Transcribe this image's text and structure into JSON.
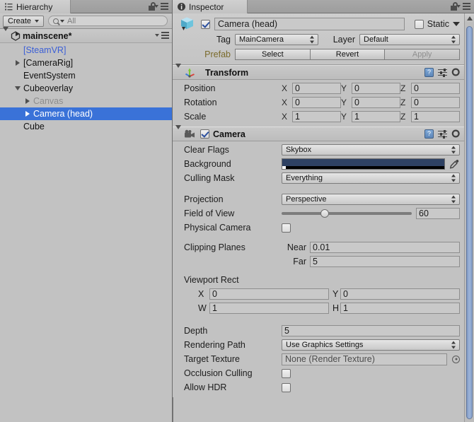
{
  "hierarchy": {
    "tab_label": "Hierarchy",
    "tab_icon": "hierarchy-icon",
    "lock_icon": "lock-icon",
    "menu_icon": "panel-menu-icon",
    "create_label": "Create",
    "search_value": "All",
    "search_icon": "search-icon",
    "scene_name": "mainscene*",
    "scene_icon": "unity-scene-icon",
    "items": [
      {
        "label": "[SteamVR]",
        "indent": 1,
        "fold": "none",
        "style": "prefab",
        "selected": false
      },
      {
        "label": "[CameraRig]",
        "indent": 1,
        "fold": "right",
        "style": "normal",
        "selected": false
      },
      {
        "label": "EventSystem",
        "indent": 1,
        "fold": "none",
        "style": "normal",
        "selected": false
      },
      {
        "label": "Cubeoverlay",
        "indent": 1,
        "fold": "down",
        "style": "normal",
        "selected": false
      },
      {
        "label": "Canvas",
        "indent": 2,
        "fold": "right",
        "style": "dim",
        "selected": false
      },
      {
        "label": "Camera (head)",
        "indent": 2,
        "fold": "right",
        "style": "normal",
        "selected": true
      },
      {
        "label": "Cube",
        "indent": 1,
        "fold": "none",
        "style": "normal",
        "selected": false
      }
    ]
  },
  "inspector": {
    "tab_label": "Inspector",
    "tab_icon": "info-icon",
    "lock_icon": "lock-icon",
    "menu_icon": "panel-menu-icon",
    "gameobject": {
      "icon": "prefab-cube-icon",
      "enabled": true,
      "name": "Camera (head)",
      "static_label": "Static",
      "static_checked": false,
      "tag_label": "Tag",
      "tag_value": "MainCamera",
      "layer_label": "Layer",
      "layer_value": "Default",
      "prefab_label": "Prefab",
      "prefab_buttons": [
        {
          "label": "Select",
          "disabled": false
        },
        {
          "label": "Revert",
          "disabled": false
        },
        {
          "label": "Apply",
          "disabled": true
        }
      ]
    },
    "components": [
      {
        "title": "Transform",
        "icon": "transform-axis-icon",
        "expanded": true,
        "has_enable_checkbox": false,
        "header_icons": [
          "help-icon",
          "preset-icon",
          "gear-icon"
        ],
        "vectors": [
          {
            "label": "Position",
            "x": "0",
            "y": "0",
            "z": "0"
          },
          {
            "label": "Rotation",
            "x": "0",
            "y": "0",
            "z": "0"
          },
          {
            "label": "Scale",
            "x": "1",
            "y": "1",
            "z": "1"
          }
        ]
      },
      {
        "title": "Camera",
        "icon": "camera-icon",
        "expanded": true,
        "has_enable_checkbox": true,
        "enabled": true,
        "header_icons": [
          "help-icon",
          "preset-icon",
          "gear-icon"
        ]
      }
    ],
    "camera": {
      "clear_flags_label": "Clear Flags",
      "clear_flags_value": "Skybox",
      "background_label": "Background",
      "background_color": "#2e4163",
      "eyedropper_icon": "eyedropper-icon",
      "culling_mask_label": "Culling Mask",
      "culling_mask_value": "Everything",
      "projection_label": "Projection",
      "projection_value": "Perspective",
      "fov_label": "Field of View",
      "fov_value": "60",
      "fov_percent": 33,
      "physical_camera_label": "Physical Camera",
      "physical_camera_checked": false,
      "clipping_label": "Clipping Planes",
      "near_label": "Near",
      "near_value": "0.01",
      "far_label": "Far",
      "far_value": "5",
      "viewport_label": "Viewport Rect",
      "viewport_x_label": "X",
      "viewport_x": "0",
      "viewport_y_label": "Y",
      "viewport_y": "0",
      "viewport_w_label": "W",
      "viewport_w": "1",
      "viewport_h_label": "H",
      "viewport_h": "1",
      "depth_label": "Depth",
      "depth_value": "5",
      "rendering_path_label": "Rendering Path",
      "rendering_path_value": "Use Graphics Settings",
      "target_texture_label": "Target Texture",
      "target_texture_value": "None (Render Texture)",
      "target_texture_picker_icon": "object-picker-icon",
      "occlusion_label": "Occlusion Culling",
      "occlusion_checked": false,
      "hdr_label": "Allow HDR",
      "hdr_checked": false
    },
    "scrollbar": {
      "up_arrow_icon": "scroll-up-arrow-icon"
    }
  },
  "colors": {
    "selection_blue": "#3a72d8",
    "prefab_blue": "#3b5fd6",
    "panel_bg": "#c2c2c2",
    "scrollbar_thumb": "#9db4d8"
  }
}
